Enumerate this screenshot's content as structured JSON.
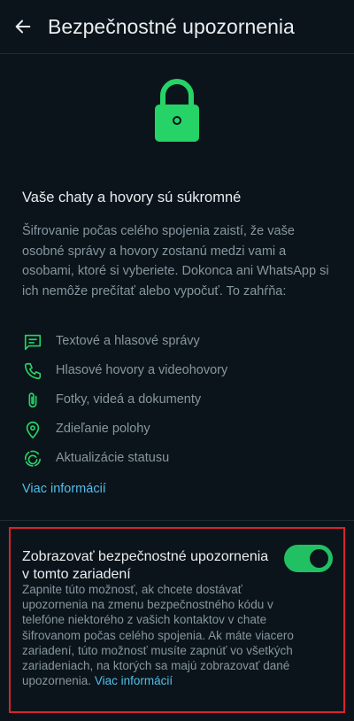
{
  "appbar": {
    "title": "Bezpečnostné upozornenia",
    "back_icon": "arrow-left-icon"
  },
  "hero": {
    "icon": "padlock-icon",
    "accent_color": "#25d366"
  },
  "intro": {
    "headline": "Vaše chaty a hovory sú súkromné",
    "description": "Šifrovanie počas celého spojenia zaistí, že vaše osobné správy a hovory zostanú medzi vami a osobami, ktoré si vyberiete. Dokonca ani WhatsApp si ich nemôže prečítať alebo vypočuť. To zahŕňa:"
  },
  "features": [
    {
      "icon": "message-icon",
      "label": "Textové a hlasové správy"
    },
    {
      "icon": "phone-icon",
      "label": "Hlasové hovory a videohovory"
    },
    {
      "icon": "attachment-icon",
      "label": "Fotky, videá a dokumenty"
    },
    {
      "icon": "location-pin-icon",
      "label": "Zdieľanie polohy"
    },
    {
      "icon": "status-icon",
      "label": "Aktualizácie statusu"
    }
  ],
  "more_link": "Viac informácií",
  "notification_setting": {
    "title": "Zobrazovať bezpečnostné upozornenia v tomto zariadení",
    "description": "Zapnite túto možnosť, ak chcete dostávať upozornenia na zmenu bezpečnostného kódu v telefóne niektorého z vašich kontaktov v chate šifrovanom počas celého spojenia. Ak máte viacero zariadení, túto možnosť musíte zapnúť vo všetkých zariadeniach, na ktorých sa majú zobrazovať dané upozornenia.",
    "link": "Viac informácií",
    "enabled": true,
    "switch_color": "#21c063"
  },
  "colors": {
    "background": "#0b141a",
    "primary_text": "#e9edef",
    "secondary_text": "#8696a0",
    "link": "#53bdeb",
    "highlight_border": "#d9232e"
  }
}
